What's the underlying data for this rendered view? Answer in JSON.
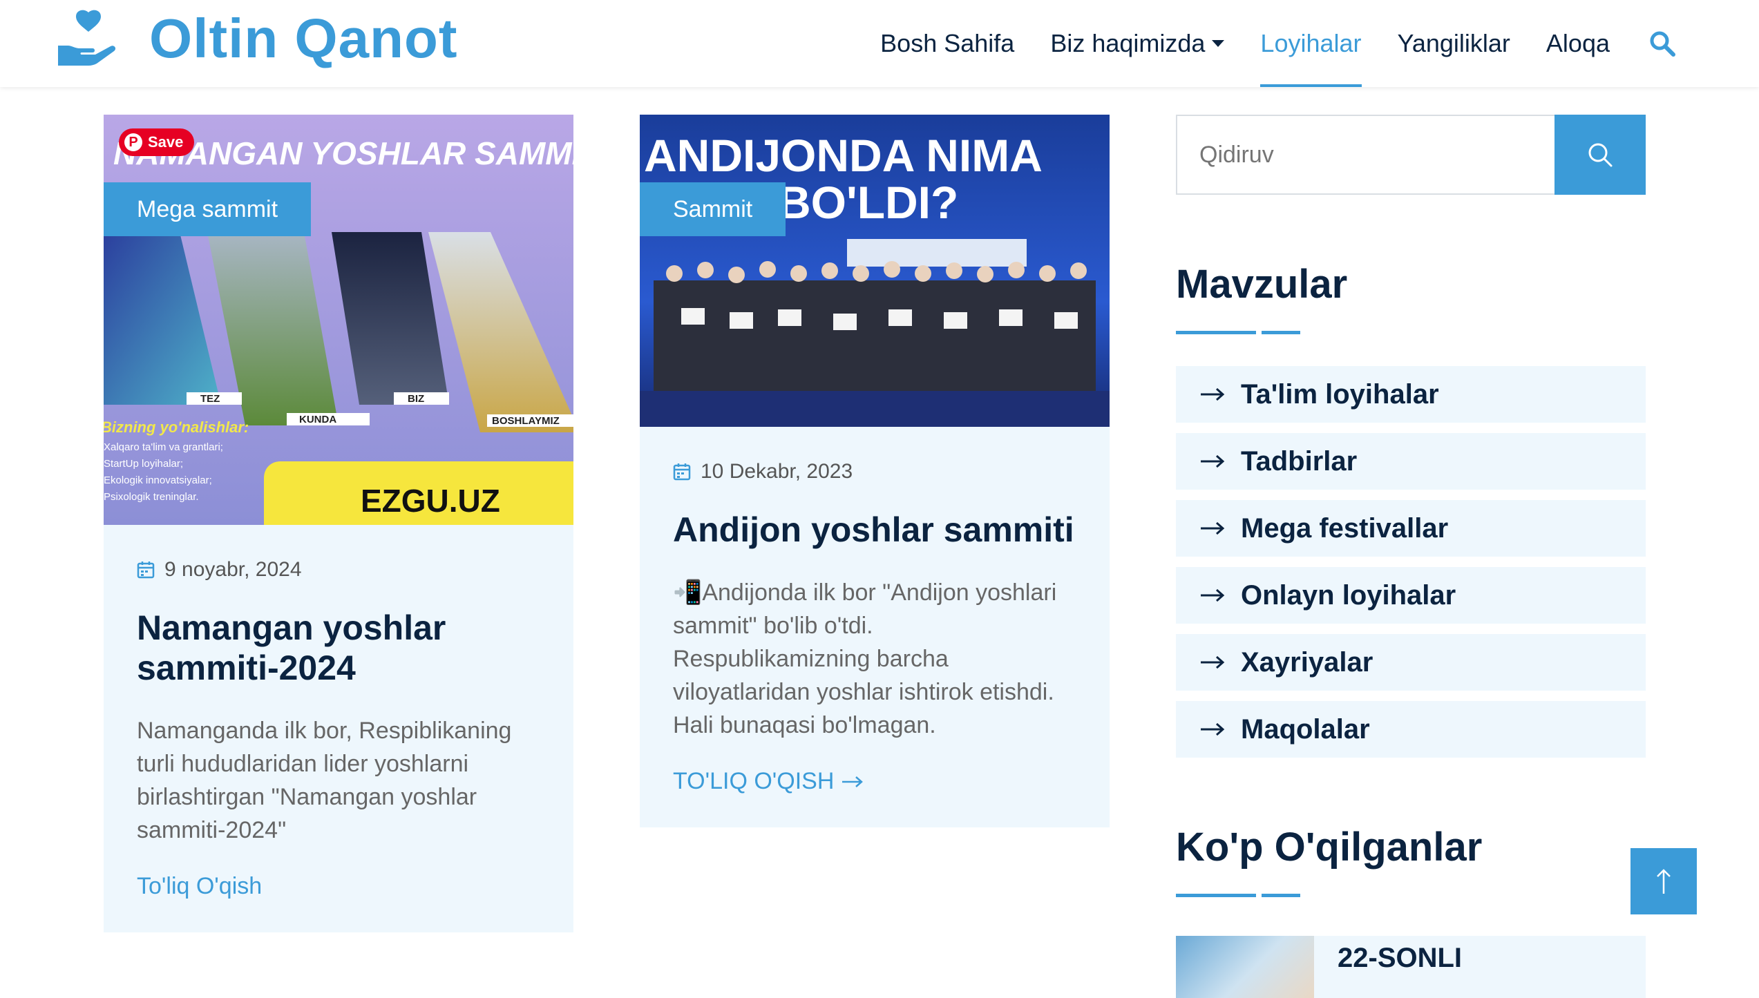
{
  "brand": {
    "name": "Oltin Qanot"
  },
  "nav": {
    "items": [
      {
        "label": "Bosh Sahifa"
      },
      {
        "label": "Biz haqimizda"
      },
      {
        "label": "Loyihalar"
      },
      {
        "label": "Yangiliklar"
      },
      {
        "label": "Aloqa"
      }
    ],
    "active": "Loyihalar"
  },
  "posts": [
    {
      "category": "Mega sammit",
      "image_text": {
        "headline": "NAMANGAN YOSHLAR SAMMITI",
        "labels": [
          "TEZ",
          "KUNDA",
          "BIZ",
          "BOSHLAYMIZ"
        ],
        "sub_title": "Bizning yo'nalishlar:",
        "list": [
          "Xalqaro ta'lim va grantlari;",
          "StartUp loyihalar;",
          "Ekologik innovatsiyalar;",
          "Psixologik treninglar."
        ],
        "site": "EZGU.UZ",
        "save": "Save"
      },
      "date": "9 noyabr, 2024",
      "title": "Namangan yoshlar sammiti-2024",
      "excerpt": "Namanganda ilk bor, Respiblikaning turli hududlaridan lider yoshlarni birlashtirgan \"Namangan yoshlar sammiti-2024\"",
      "read_more": "To'liq O'qish"
    },
    {
      "category": "Sammit",
      "image_text": {
        "headline_1": "ANDIJONDA NIMA",
        "headline_2": "BO'LDI?"
      },
      "date": "10 Dekabr, 2023",
      "title": "Andijon yoshlar sammiti",
      "excerpt": "📲Andijonda ilk bor \"Andijon yoshlari sammit\" bo'lib o'tdi. Respublikamizning barcha viloyatlaridan yoshlar ishtirok etishdi. Hali bunaqasi bo'lmagan.",
      "read_more": "TO'LIQ O'QISH"
    }
  ],
  "sidebar": {
    "search": {
      "placeholder": "Qidiruv"
    },
    "topics_title": "Mavzular",
    "topics": [
      {
        "label": "Ta'lim loyihalar"
      },
      {
        "label": "Tadbirlar"
      },
      {
        "label": "Mega festivallar"
      },
      {
        "label": "Onlayn loyihalar"
      },
      {
        "label": "Xayriyalar"
      },
      {
        "label": "Maqolalar"
      }
    ],
    "popular_title": "Ko'p O'qilganlar",
    "popular": [
      {
        "title": "22-SONLI"
      }
    ]
  },
  "colors": {
    "accent": "#3b9bd8",
    "card_bg": "#eef7fd",
    "heading": "#0b2340"
  }
}
